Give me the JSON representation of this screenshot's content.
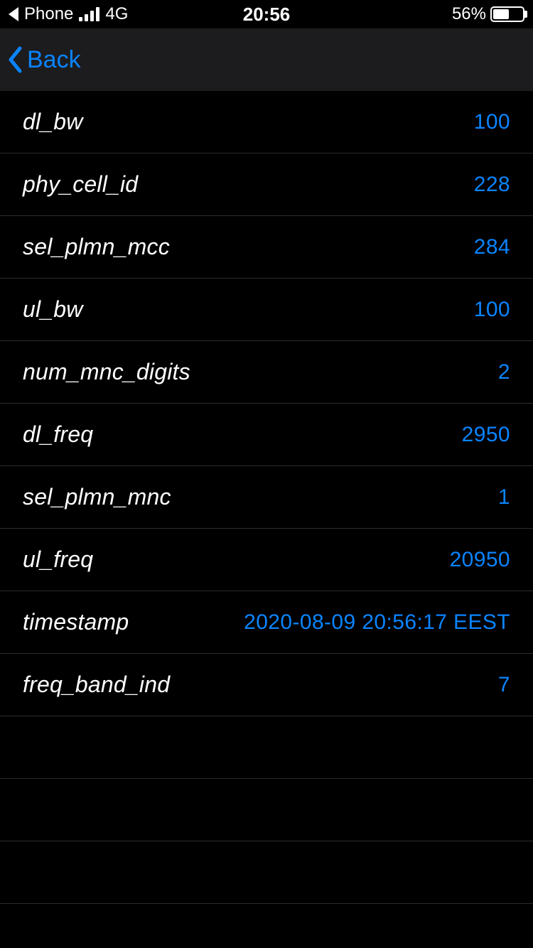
{
  "status": {
    "breadcrumb_app": "Phone",
    "network_type": "4G",
    "time": "20:56",
    "battery_percent": "56%"
  },
  "nav": {
    "back_label": "Back"
  },
  "rows": [
    {
      "key": "dl_bw",
      "value": "100"
    },
    {
      "key": "phy_cell_id",
      "value": "228"
    },
    {
      "key": "sel_plmn_mcc",
      "value": "284"
    },
    {
      "key": "ul_bw",
      "value": "100"
    },
    {
      "key": "num_mnc_digits",
      "value": "2"
    },
    {
      "key": "dl_freq",
      "value": "2950"
    },
    {
      "key": "sel_plmn_mnc",
      "value": "1"
    },
    {
      "key": "ul_freq",
      "value": "20950"
    },
    {
      "key": "timestamp",
      "value": "2020-08-09 20:56:17 EEST"
    },
    {
      "key": "freq_band_ind",
      "value": "7"
    },
    {
      "key": "",
      "value": ""
    },
    {
      "key": "",
      "value": ""
    },
    {
      "key": "",
      "value": ""
    }
  ]
}
